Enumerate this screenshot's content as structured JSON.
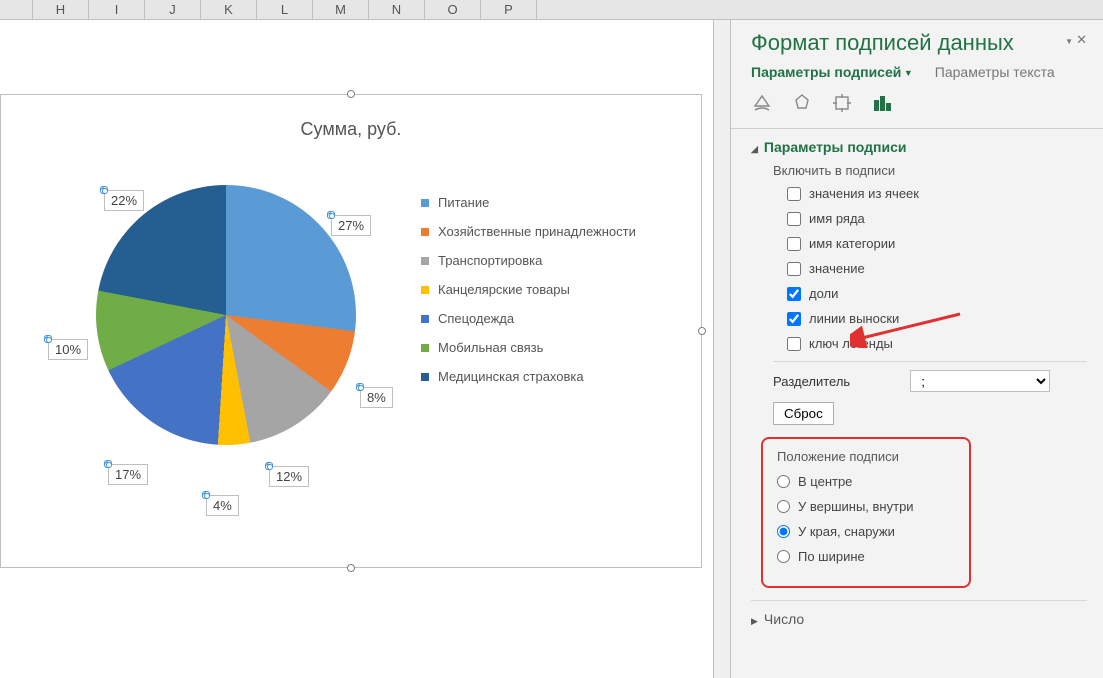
{
  "columns": [
    "H",
    "I",
    "J",
    "K",
    "L",
    "M",
    "N",
    "O",
    "P"
  ],
  "chart": {
    "title": "Сумма, руб.",
    "legend": [
      {
        "label": "Питание",
        "color": "#5b9bd5"
      },
      {
        "label": "Хозяйственные принадлежности",
        "color": "#ed7d31"
      },
      {
        "label": "Транспортировка",
        "color": "#a5a5a5"
      },
      {
        "label": "Канцелярские товары",
        "color": "#ffc000"
      },
      {
        "label": "Спецодежда",
        "color": "#4472c4"
      },
      {
        "label": "Мобильная связь",
        "color": "#70ad47"
      },
      {
        "label": "Медицинская страховка",
        "color": "#255e91"
      }
    ]
  },
  "chart_data": {
    "type": "pie",
    "title": "Сумма, руб.",
    "categories": [
      "Питание",
      "Хозяйственные принадлежности",
      "Транспортировка",
      "Канцелярские товары",
      "Спецодежда",
      "Мобильная связь",
      "Медицинская страховка"
    ],
    "values_pct": [
      27,
      8,
      12,
      4,
      17,
      10,
      22
    ],
    "colors": [
      "#5b9bd5",
      "#ed7d31",
      "#a5a5a5",
      "#ffc000",
      "#4472c4",
      "#70ad47",
      "#255e91"
    ],
    "data_labels": "percentage_outside"
  },
  "data_labels": {
    "v0": "27%",
    "v1": "8%",
    "v2": "12%",
    "v3": "4%",
    "v4": "17%",
    "v5": "10%",
    "v6": "22%"
  },
  "panel": {
    "title": "Формат подписей данных",
    "tab_label_options": "Параметры подписей",
    "tab_text_options": "Параметры текста",
    "section_label_options": "Параметры подписи",
    "include_title": "Включить в подписи",
    "chk_cells": "значения из ячеек",
    "chk_series": "имя ряда",
    "chk_category": "имя категории",
    "chk_value": "значение",
    "chk_percent": "доли",
    "chk_leader": "линии выноски",
    "chk_legend_key": "ключ легенды",
    "separator_label": "Разделитель",
    "separator_value": ";",
    "reset": "Сброс",
    "position_title": "Положение подписи",
    "pos_center": "В центре",
    "pos_inside_end": "У вершины, внутри",
    "pos_outside_end": "У края, снаружи",
    "pos_bestfit": "По ширине",
    "section_number": "Число"
  }
}
